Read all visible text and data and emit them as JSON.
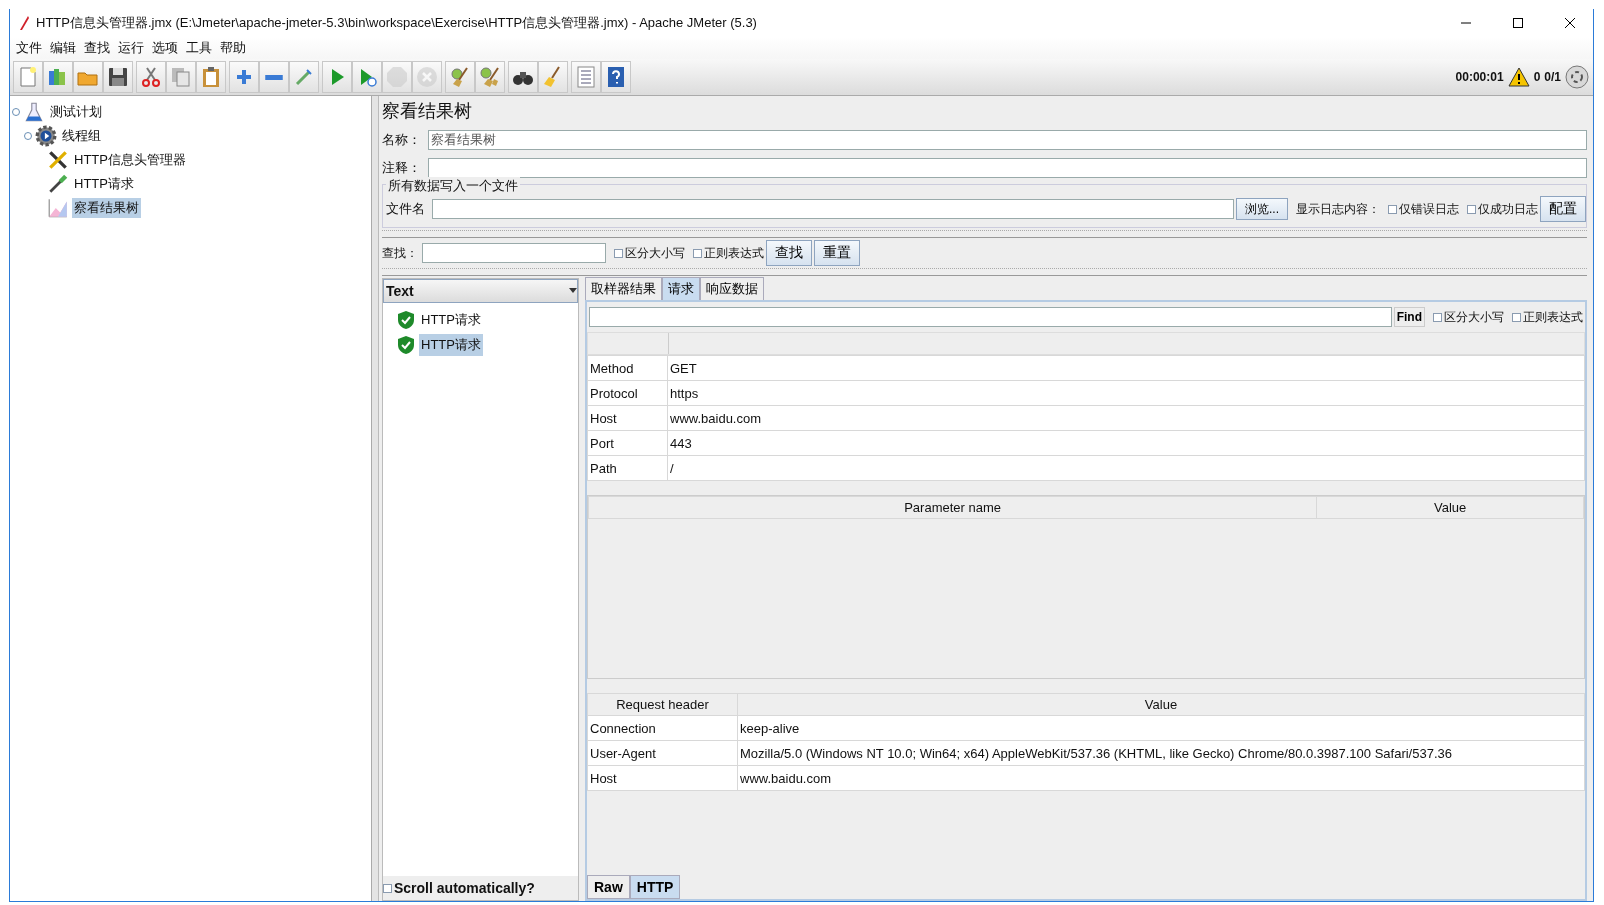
{
  "window": {
    "title": "HTTP信息头管理器.jmx (E:\\Jmeter\\apache-jmeter-5.3\\bin\\workspace\\Exercise\\HTTP信息头管理器.jmx) - Apache JMeter (5.3)"
  },
  "menu": [
    "文件",
    "编辑",
    "查找",
    "运行",
    "选项",
    "工具",
    "帮助"
  ],
  "toolbar": [
    [
      {
        "kind": "new",
        "disabled": false
      },
      {
        "kind": "templates",
        "disabled": false
      },
      {
        "kind": "open",
        "disabled": false
      },
      {
        "kind": "save",
        "disabled": false
      }
    ],
    [
      {
        "kind": "cut",
        "disabled": false
      },
      {
        "kind": "copy",
        "disabled": false
      },
      {
        "kind": "paste",
        "disabled": false
      }
    ],
    [
      {
        "kind": "expand",
        "disabled": false
      },
      {
        "kind": "collapse",
        "disabled": false
      },
      {
        "kind": "toggle",
        "disabled": false
      }
    ],
    [
      {
        "kind": "start",
        "disabled": false
      },
      {
        "kind": "start-no-pause",
        "disabled": false
      },
      {
        "kind": "stop",
        "disabled": true
      },
      {
        "kind": "shutdown",
        "disabled": true
      }
    ],
    [
      {
        "kind": "clear",
        "disabled": false
      },
      {
        "kind": "clear-all",
        "disabled": false
      }
    ],
    [
      {
        "kind": "search",
        "disabled": false
      },
      {
        "kind": "reset-search",
        "disabled": false
      }
    ],
    [
      {
        "kind": "function",
        "disabled": false
      },
      {
        "kind": "help",
        "disabled": false
      }
    ]
  ],
  "status": {
    "elapsed": "00:00:01",
    "warnings": "0",
    "threads": "0/1"
  },
  "tree": [
    {
      "label": "测试计划",
      "kind": "plan",
      "selected": false,
      "expanded": true,
      "children": [
        {
          "label": "线程组",
          "kind": "thread-group",
          "selected": false,
          "expanded": true,
          "children": [
            {
              "label": "HTTP信息头管理器",
              "kind": "config",
              "selected": false
            },
            {
              "label": "HTTP请求",
              "kind": "sampler",
              "selected": false
            },
            {
              "label": "察看结果树",
              "kind": "listener",
              "selected": true
            }
          ]
        }
      ]
    }
  ],
  "panel": {
    "title": "察看结果树",
    "name_label": "名称：",
    "name_value": "察看结果树",
    "comment_label": "注释：",
    "file_group": "所有数据写入一个文件",
    "file_label": "文件名",
    "browse": "浏览...",
    "log_label": "显示日志内容：",
    "log_options": [
      {
        "label": "仅错误日志",
        "checked": false
      },
      {
        "label": "仅成功日志",
        "checked": false
      }
    ],
    "configure": "配置"
  },
  "search": {
    "label": "查找：",
    "options": [
      {
        "label": "区分大小写",
        "checked": false
      },
      {
        "label": "正则表达式",
        "checked": false
      }
    ],
    "buttons": [
      "查找",
      "重置"
    ]
  },
  "results": {
    "renderer": "Text",
    "items": [
      {
        "label": "HTTP请求",
        "selected": false
      },
      {
        "label": "HTTP请求",
        "selected": true
      }
    ],
    "scroll_auto": {
      "label": "Scroll automatically?",
      "checked": false
    }
  },
  "detail_tabs": [
    {
      "label": "取样器结果",
      "selected": false
    },
    {
      "label": "请求",
      "selected": true
    },
    {
      "label": "响应数据",
      "selected": false
    }
  ],
  "find": {
    "button": "Find",
    "options": [
      {
        "label": "区分大小写",
        "checked": false
      },
      {
        "label": "正则表达式",
        "checked": false
      }
    ]
  },
  "request_table": {
    "rows": [
      [
        "Method",
        "GET"
      ],
      [
        "Protocol",
        "https"
      ],
      [
        "Host",
        "www.baidu.com"
      ],
      [
        "Port",
        "443"
      ],
      [
        "Path",
        "/"
      ]
    ]
  },
  "params_table": {
    "columns": [
      "Parameter name",
      "Value"
    ]
  },
  "headers_table": {
    "columns": [
      "Request header",
      "Value"
    ],
    "rows": [
      [
        "Connection",
        "keep-alive"
      ],
      [
        "User-Agent",
        "Mozilla/5.0 (Windows NT 10.0; Win64; x64) AppleWebKit/537.36 (KHTML, like Gecko) Chrome/80.0.3987.100 Safari/537.36"
      ],
      [
        "Host",
        "www.baidu.com"
      ]
    ]
  },
  "bottom_tabs": [
    {
      "label": "Raw",
      "selected": false
    },
    {
      "label": "HTTP",
      "selected": true
    }
  ]
}
